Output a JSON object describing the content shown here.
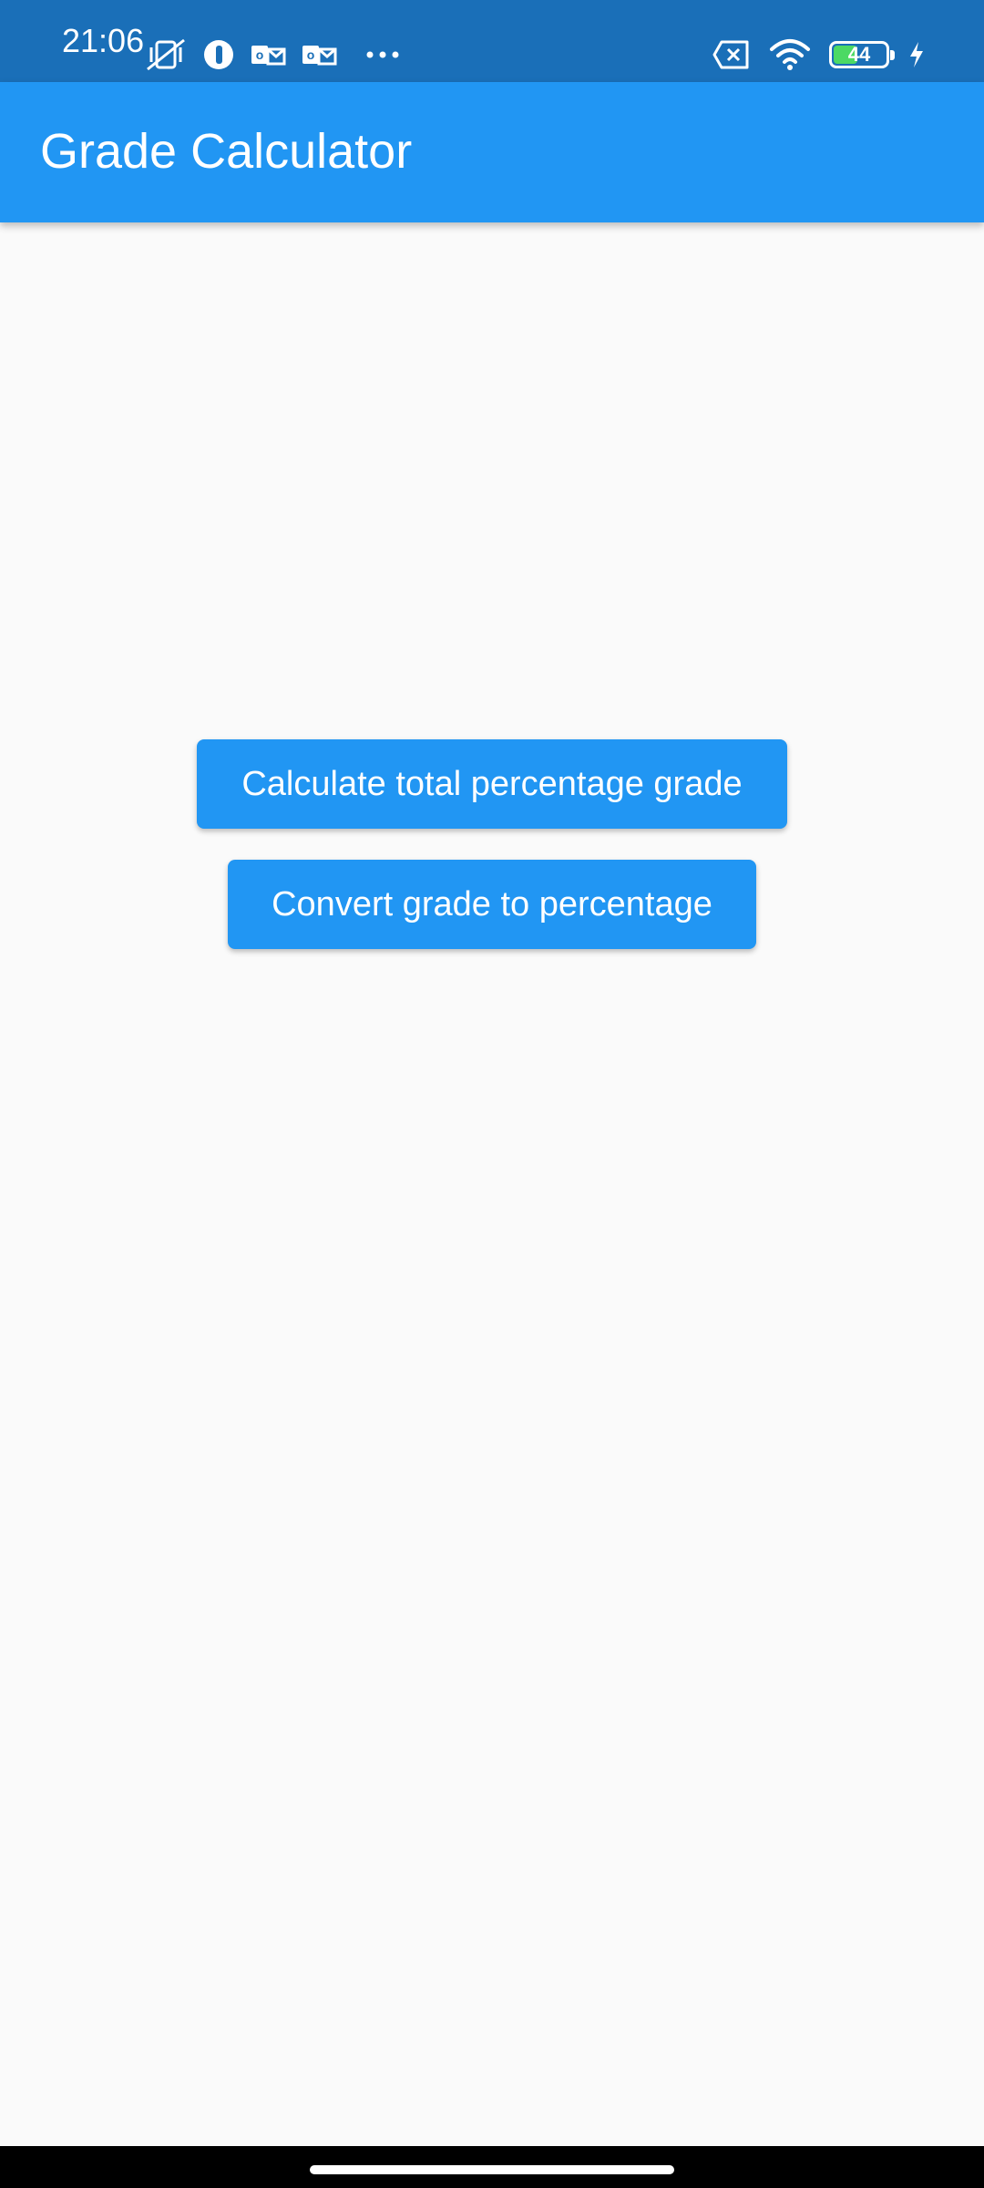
{
  "status_bar": {
    "time": "21:06",
    "battery_level": "44",
    "battery_fraction": 0.44,
    "left_icons": [
      "vibrate-icon",
      "app-icon",
      "outlook-icon",
      "outlook-icon",
      "more-dots-icon"
    ],
    "right_icons": [
      "no-sim-icon",
      "wifi-icon",
      "battery-icon",
      "charging-icon"
    ],
    "background_color": "#1a6fb8"
  },
  "app_bar": {
    "title": "Grade Calculator",
    "color": "#2196f3"
  },
  "main": {
    "buttons": [
      {
        "label": "Calculate total percentage grade"
      },
      {
        "label": "Convert grade to percentage"
      }
    ]
  },
  "colors": {
    "background": "#fafafa",
    "accent": "#2196f3",
    "battery_fill": "#4cd964"
  }
}
